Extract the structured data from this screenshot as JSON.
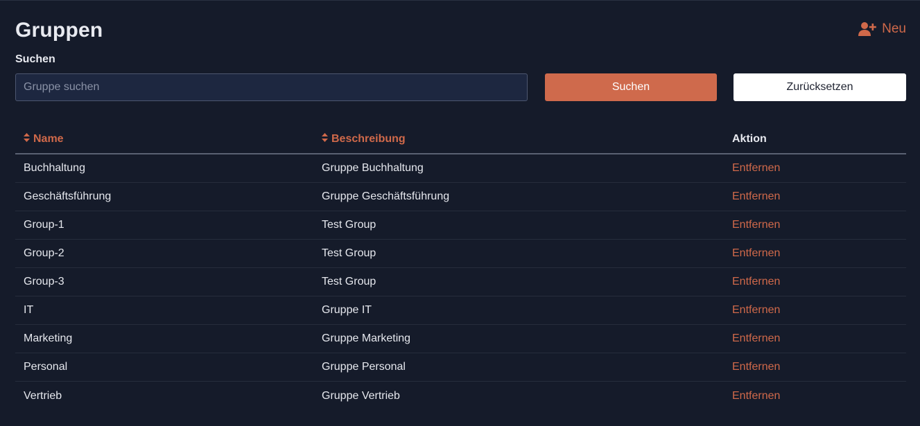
{
  "header": {
    "title": "Gruppen",
    "new_label": "Neu",
    "new_icon": "user-plus-icon"
  },
  "search": {
    "label": "Suchen",
    "placeholder": "Gruppe suchen",
    "value": "",
    "search_button": "Suchen",
    "reset_button": "Zurücksetzen"
  },
  "table": {
    "columns": {
      "name": "Name",
      "description": "Beschreibung",
      "action": "Aktion"
    },
    "rows": [
      {
        "name": "Buchhaltung",
        "description": "Gruppe Buchhaltung",
        "action": "Entfernen"
      },
      {
        "name": "Geschäftsführung",
        "description": "Gruppe Geschäftsführung",
        "action": "Entfernen"
      },
      {
        "name": "Group-1",
        "description": "Test Group",
        "action": "Entfernen"
      },
      {
        "name": "Group-2",
        "description": "Test Group",
        "action": "Entfernen"
      },
      {
        "name": "Group-3",
        "description": "Test Group",
        "action": "Entfernen"
      },
      {
        "name": "IT",
        "description": "Gruppe IT",
        "action": "Entfernen"
      },
      {
        "name": "Marketing",
        "description": "Gruppe Marketing",
        "action": "Entfernen"
      },
      {
        "name": "Personal",
        "description": "Gruppe Personal",
        "action": "Entfernen"
      },
      {
        "name": "Vertrieb",
        "description": "Gruppe Vertrieb",
        "action": "Entfernen"
      }
    ]
  },
  "colors": {
    "background": "#151b2a",
    "accent": "#cf6a4c",
    "input_bg": "#1d2740"
  }
}
